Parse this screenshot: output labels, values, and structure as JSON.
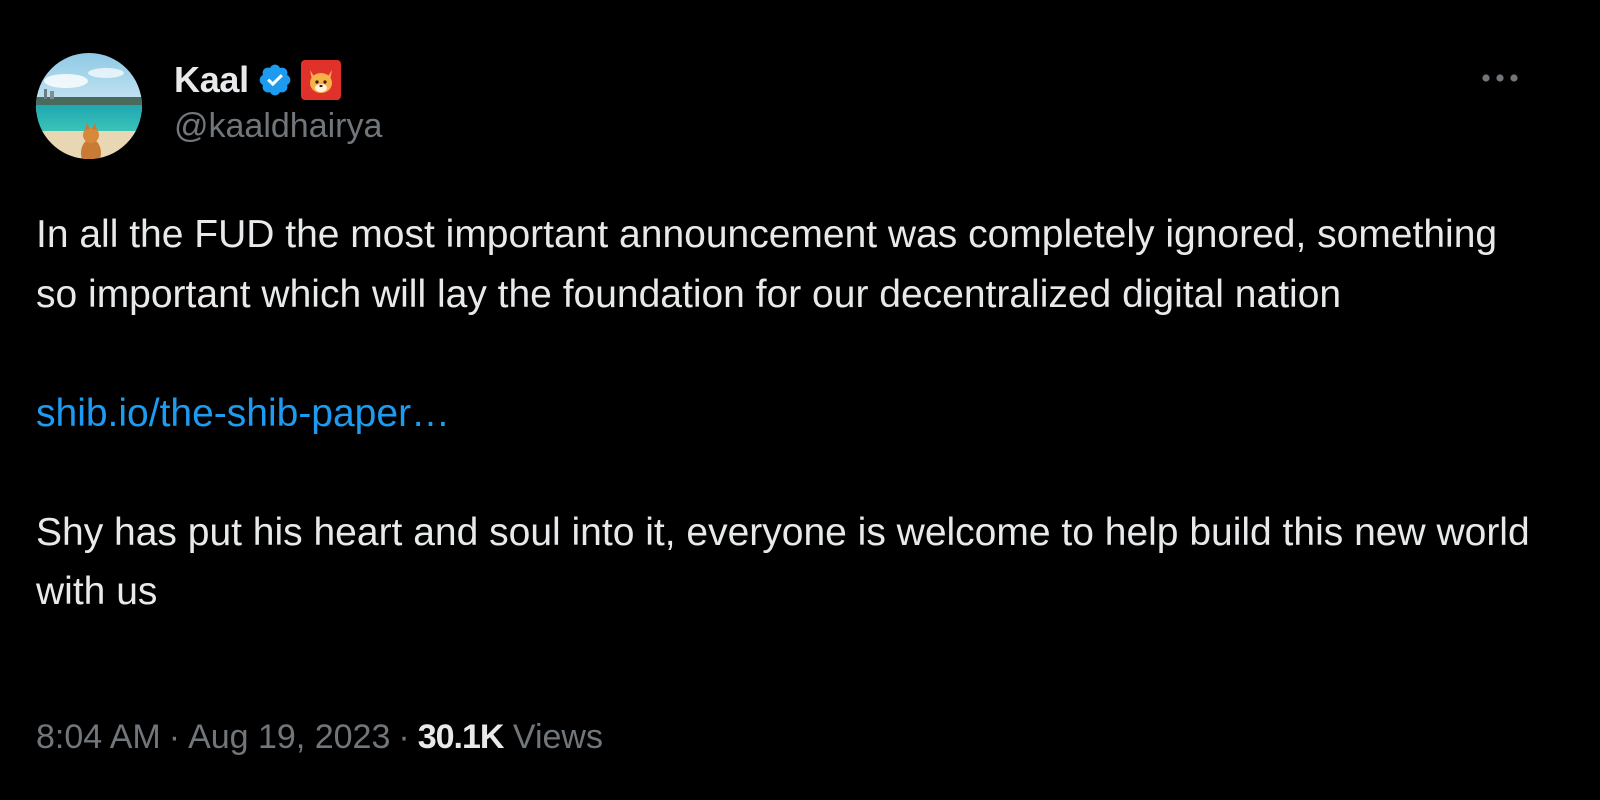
{
  "author": {
    "display_name": "Kaal",
    "handle": "@kaaldhairya",
    "verified": true,
    "avatar_icon": "beach-avatar-with-shiba",
    "affiliate_badge_icon": "shiba-inu-badge-icon"
  },
  "menu": {
    "icon": "more-dots-icon"
  },
  "tweet": {
    "paragraph_1": "In all the FUD the most important announcement was completely ignored, something so important which will lay the foundation for our decentralized digital nation",
    "link_text": "shib.io/the-shib-paper…",
    "paragraph_2": "Shy has put his heart and soul into it, everyone is welcome to help build this new world with us"
  },
  "meta": {
    "time": "8:04 AM",
    "separator": "·",
    "date": "Aug 19, 2023",
    "views_count": "30.1K",
    "views_label": "Views"
  },
  "colors": {
    "background": "#000000",
    "text_primary": "#e7e9ea",
    "text_secondary": "#71767b",
    "link": "#1d9bf0",
    "verified": "#1d9bf0",
    "badge": "#e0312a"
  }
}
